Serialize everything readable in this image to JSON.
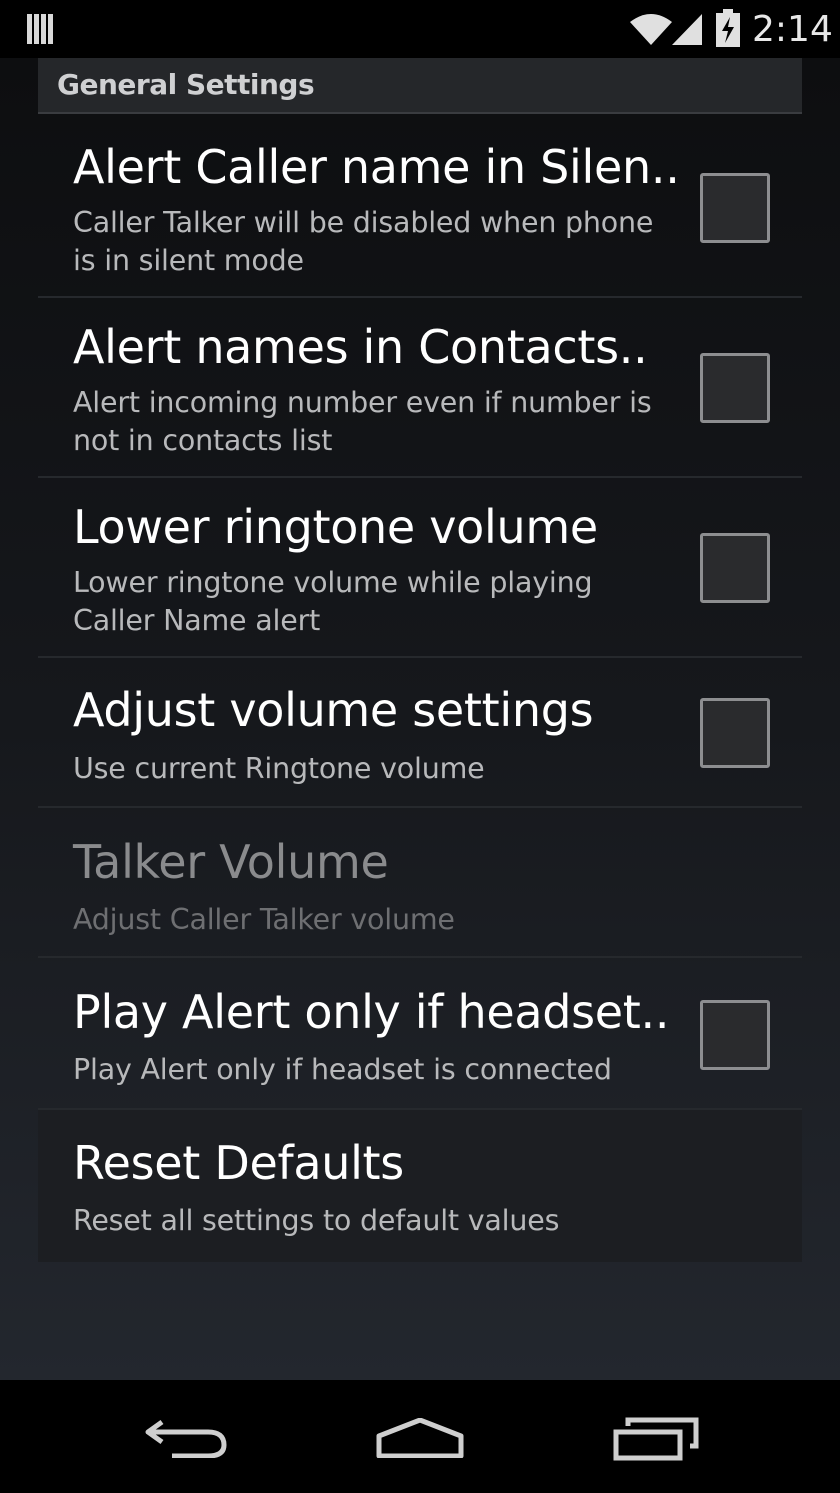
{
  "status_bar": {
    "time": "2:14",
    "icons": [
      "notification-bars-icon",
      "wifi-icon",
      "cell-signal-icon",
      "battery-charging-icon"
    ]
  },
  "section": {
    "title": "General Settings"
  },
  "preferences": [
    {
      "title": "Alert Caller name in Silen..",
      "summary": "Caller Talker will be disabled when phone is in silent mode",
      "checkbox": true,
      "checked": false,
      "enabled": true
    },
    {
      "title": "Alert names in Contacts..",
      "summary": "Alert incoming number even if number is not in contacts list",
      "checkbox": true,
      "checked": false,
      "enabled": true
    },
    {
      "title": "Lower ringtone volume",
      "summary": "Lower ringtone volume while playing Caller Name alert",
      "checkbox": true,
      "checked": false,
      "enabled": true
    },
    {
      "title": "Adjust volume settings",
      "summary": "Use current Ringtone volume",
      "checkbox": true,
      "checked": false,
      "enabled": true
    },
    {
      "title": "Talker Volume",
      "summary": "Adjust Caller Talker volume",
      "checkbox": false,
      "enabled": false
    },
    {
      "title": "Play Alert only if headset..",
      "summary": "Play Alert only if headset is connected",
      "checkbox": true,
      "checked": false,
      "enabled": true
    },
    {
      "title": "Reset Defaults",
      "summary": "Reset all settings to default values",
      "checkbox": false,
      "enabled": true
    }
  ],
  "nav_bar": {
    "icons": [
      "back-icon",
      "home-icon",
      "recent-apps-icon"
    ]
  }
}
